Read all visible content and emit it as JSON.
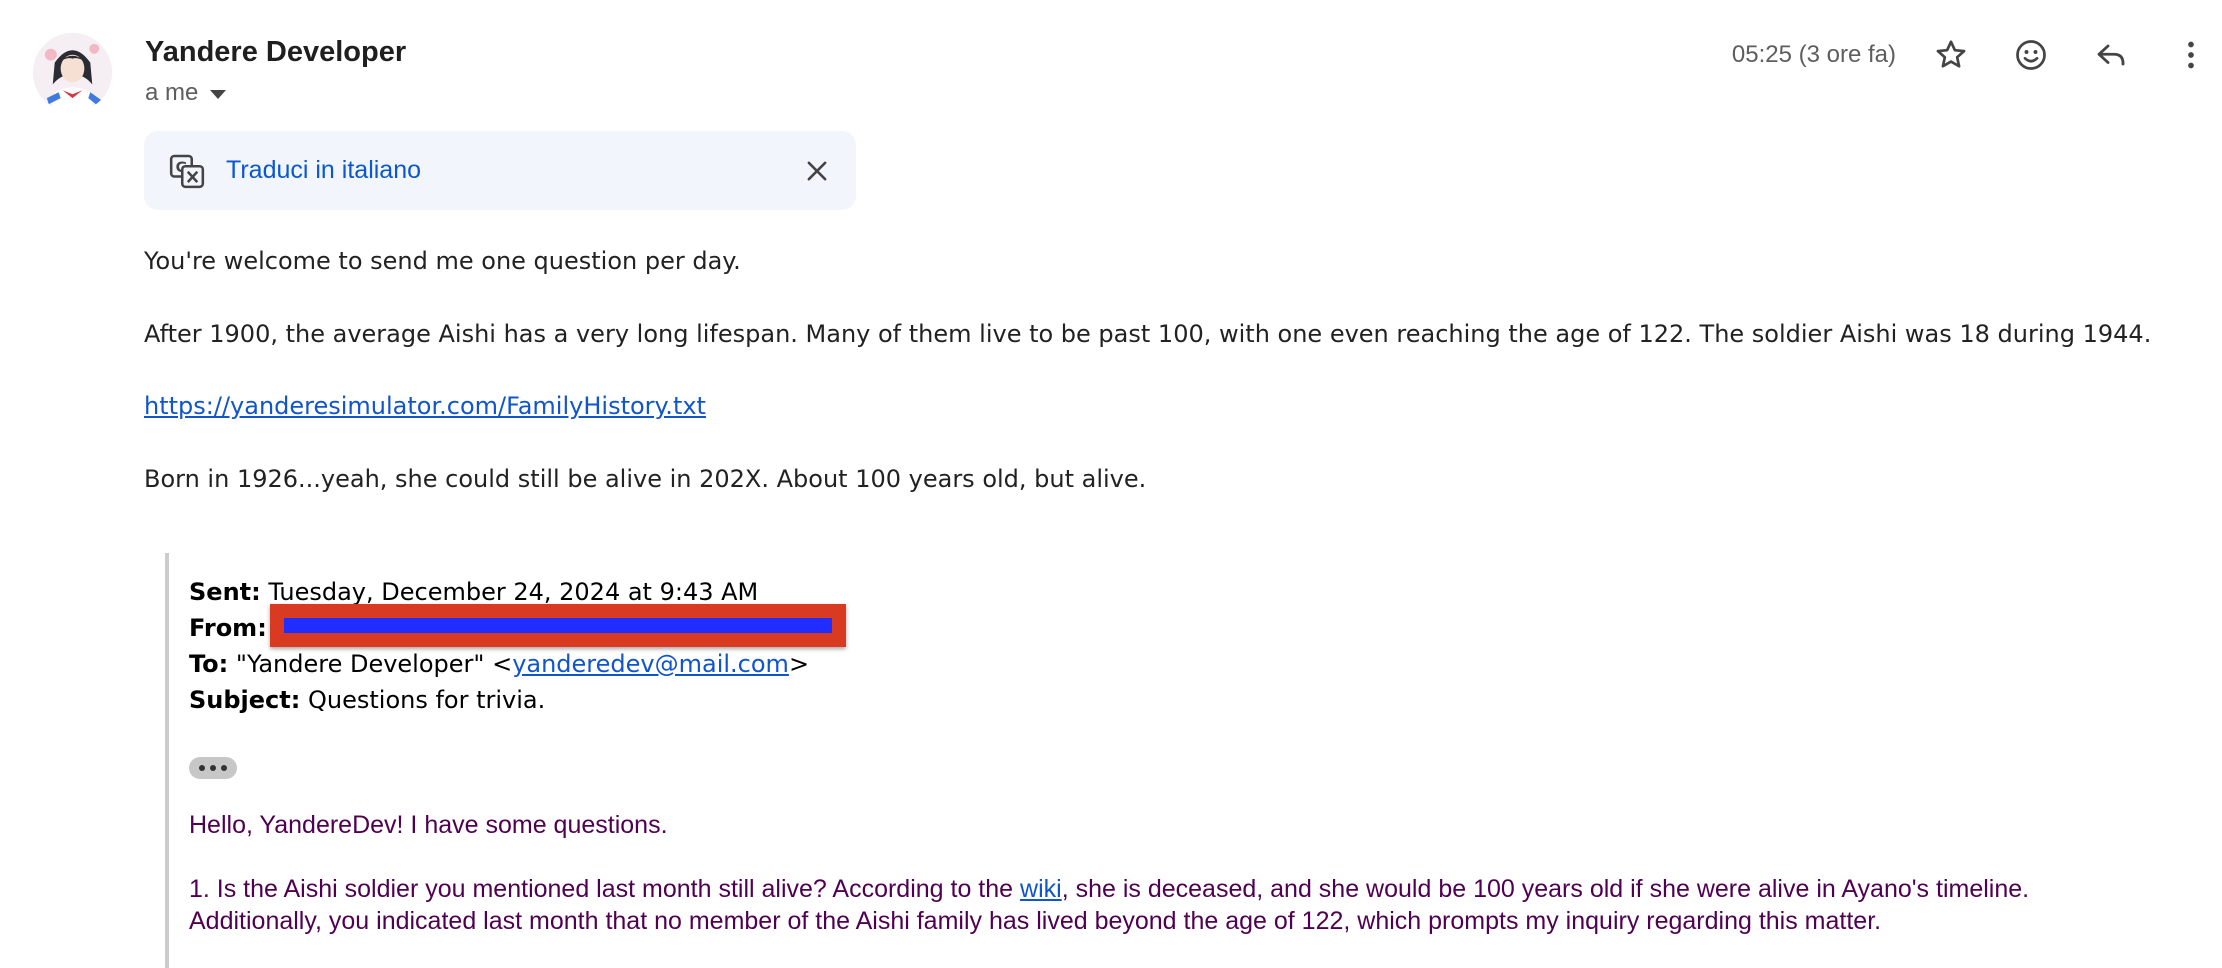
{
  "sender": {
    "name": "Yandere Developer",
    "recipient_label": "a me"
  },
  "header": {
    "timestamp": "05:25 (3 ore fa)",
    "actions": [
      "star-icon",
      "emoji-icon",
      "reply-icon",
      "more-vert-icon"
    ]
  },
  "translate_bar": {
    "label": "Traduci in italiano"
  },
  "body": {
    "p1": "You're welcome to send me one question per day.",
    "p2": "After 1900, the average Aishi has a very long lifespan. Many of them live to be past 100, with one even reaching the age of 122. The soldier Aishi was 18 during 1944.",
    "link": "https://yanderesimulator.com/FamilyHistory.txt",
    "p3": "Born in 1926...yeah, she could still be alive in 202X. About 100 years old, but alive."
  },
  "quoted": {
    "sent_label": "Sent:",
    "sent_value": "Tuesday, December 24, 2024 at 9:43 AM",
    "from_label": "From:",
    "to_label": "To:",
    "to_name": "\"Yandere Developer\" <",
    "to_email": "yanderedev@mail.com",
    "to_close": ">",
    "subject_label": "Subject:",
    "subject_value": "Questions for trivia.",
    "greeting": "Hello, YandereDev! I have some questions.",
    "q1_before": "1. Is the Aishi soldier you mentioned last month still alive? According to the ",
    "q1_link": "wiki",
    "q1_after": ", she is deceased, and she would be 100 years old if she were alive in Ayano's timeline.",
    "q1_line2": "Additionally, you indicated last month that no member of the Aishi family has lived beyond the age of 122, which prompts my inquiry regarding this matter."
  },
  "colors": {
    "link": "#1155cc",
    "translate_link": "#0b57d0",
    "quoted_text": "#500050",
    "redaction_outer": "#d83a22",
    "redaction_inner": "#1f2dff"
  }
}
